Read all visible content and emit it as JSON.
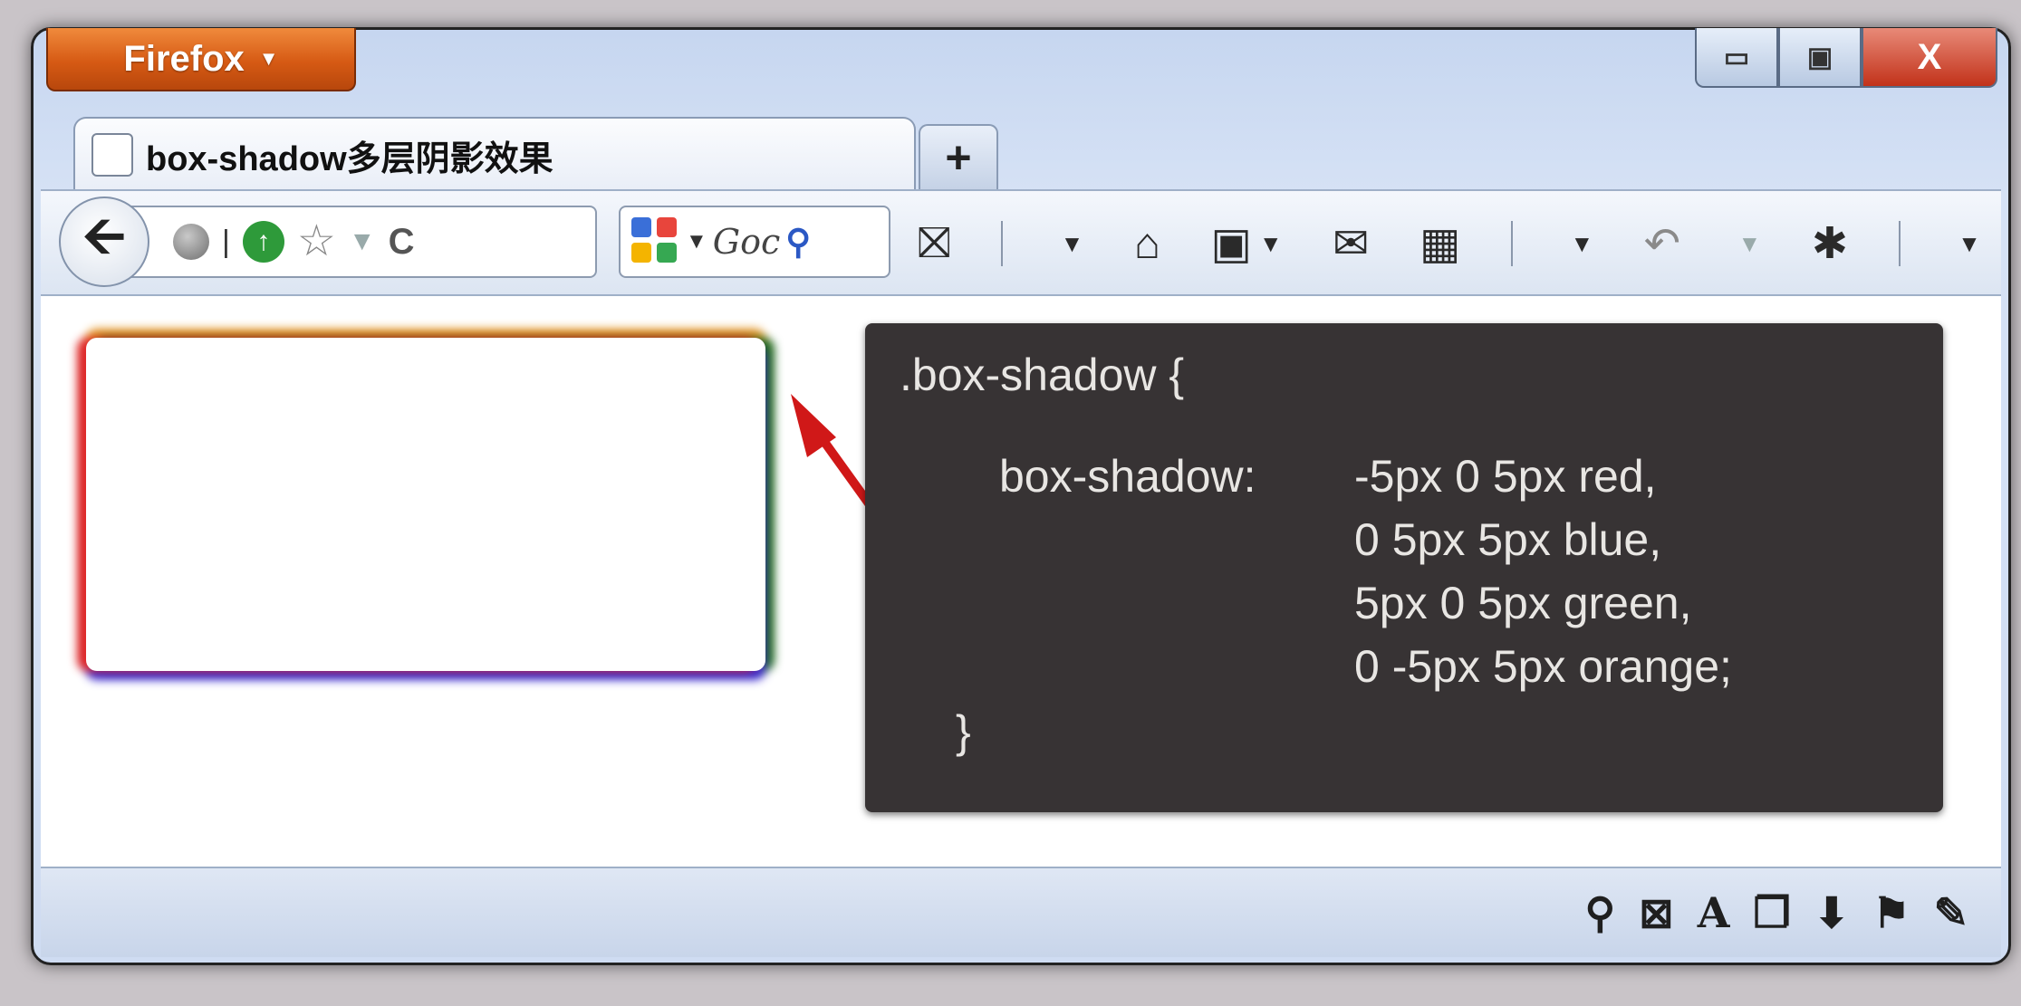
{
  "app": {
    "menu_button": "Firefox",
    "menu_caret": "▼"
  },
  "window_controls": {
    "minimize": "▭",
    "maximize": "▣",
    "close": "X"
  },
  "tab": {
    "title": "box-shadow多层阴影效果",
    "new_tab": "+"
  },
  "navbar": {
    "back": "🡨",
    "reload": "C",
    "search_placeholder": "Goc"
  },
  "code": {
    "selector_open": ".box-shadow {",
    "property": "box-shadow:",
    "values": [
      "-5px 0 5px red,",
      "0 5px 5px blue,",
      "5px 0 5px green,",
      "0 -5px 5px orange;"
    ],
    "close": "}"
  },
  "demo": {
    "shadow_colors": [
      "#e02828",
      "#3b2ad0",
      "#1f6a1f",
      "#e39422"
    ]
  },
  "colors": {
    "firefox_button": "#d65a14",
    "close_button": "#c2321a",
    "code_bg": "#373334",
    "arrow": "#d01818"
  }
}
